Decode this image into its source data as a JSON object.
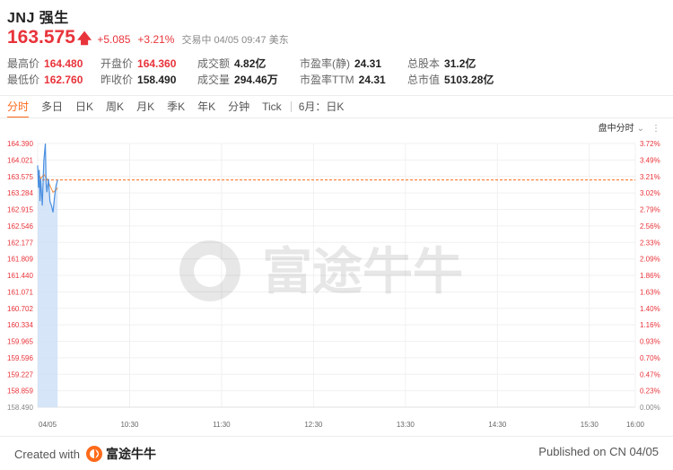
{
  "header": {
    "title": "JNJ 强生",
    "price": "163.575",
    "change": "+5.085",
    "change_pct": "+3.21%",
    "status": "交易中 04/05 09:47 美东"
  },
  "stats": [
    {
      "label": "最高价",
      "value": "164.480",
      "color": "red"
    },
    {
      "label": "开盘价",
      "value": "164.360",
      "color": "red"
    },
    {
      "label": "成交额",
      "value": "4.82亿",
      "color": ""
    },
    {
      "label": "市盈率(静)",
      "value": "24.31",
      "color": ""
    },
    {
      "label": "总股本",
      "value": "31.2亿",
      "color": ""
    },
    {
      "label": "最低价",
      "value": "162.760",
      "color": "red"
    },
    {
      "label": "昨收价",
      "value": "158.490",
      "color": ""
    },
    {
      "label": "成交量",
      "value": "294.46万",
      "color": ""
    },
    {
      "label": "市盈率TTM",
      "value": "24.31",
      "color": ""
    },
    {
      "label": "总市值",
      "value": "5103.28亿",
      "color": ""
    }
  ],
  "tabs": [
    "分时",
    "多日",
    "日K",
    "周K",
    "月K",
    "季K",
    "年K",
    "分钟",
    "Tick",
    "6月：日K"
  ],
  "active_tab": 0,
  "chart_mode": {
    "label": "盘中分时",
    "chevron_icon": "chevron-down-icon",
    "more_icon": "dots-icon"
  },
  "watermark": {
    "text": "富途牛牛",
    "icon": "futu-logo-icon"
  },
  "colors": {
    "up": "#e8333a",
    "down": "#16a05a",
    "accent": "#ff6a1a",
    "line": "#4a8fe0",
    "avg": "#f08c3c"
  },
  "chart_data": {
    "type": "line",
    "title": "",
    "xlabel": "",
    "ylabel": "",
    "prev_close": 158.49,
    "ylim": [
      158.49,
      164.39
    ],
    "y_ticks_left": [
      "164.390",
      "164.021",
      "163.575",
      "163.284",
      "162.915",
      "162.546",
      "162.177",
      "161.809",
      "161.440",
      "161.071",
      "160.702",
      "160.334",
      "159.965",
      "159.596",
      "159.227",
      "158.859",
      "158.490"
    ],
    "y_ticks_right": [
      "3.72%",
      "3.49%",
      "3.21%",
      "3.02%",
      "2.79%",
      "2.56%",
      "2.33%",
      "2.09%",
      "1.86%",
      "1.63%",
      "1.40%",
      "1.16%",
      "0.93%",
      "0.70%",
      "0.47%",
      "0.23%",
      "0.00%"
    ],
    "x_ticks": [
      "04/05",
      "10:30",
      "11:30",
      "12:30",
      "13:30",
      "14:30",
      "15:30",
      "16:00"
    ],
    "x_tick_minutes": [
      0,
      60,
      120,
      180,
      240,
      300,
      360,
      390
    ],
    "current_price": 163.575,
    "series": [
      {
        "values": [
          [
            0,
            163.9
          ],
          [
            0.5,
            163.4
          ],
          [
            1,
            163.8
          ],
          [
            1.5,
            163.1
          ],
          [
            2,
            163.6
          ],
          [
            3,
            163.0
          ],
          [
            4,
            164.0
          ],
          [
            5,
            164.39
          ],
          [
            5.5,
            163.5
          ],
          [
            6,
            163.3
          ],
          [
            7,
            163.6
          ],
          [
            8,
            163.1
          ],
          [
            9,
            163.0
          ],
          [
            10,
            162.85
          ],
          [
            11,
            163.2
          ],
          [
            12,
            163.45
          ],
          [
            13,
            163.575
          ]
        ]
      },
      {
        "values": [
          [
            0,
            163.8
          ],
          [
            2,
            163.6
          ],
          [
            4,
            163.7
          ],
          [
            6,
            163.6
          ],
          [
            8,
            163.45
          ],
          [
            10,
            163.3
          ],
          [
            12,
            163.35
          ],
          [
            13,
            163.4
          ]
        ]
      }
    ]
  },
  "footer": {
    "created_label": "Created with",
    "brand": "富途牛牛",
    "published": "Published on CN 04/05"
  }
}
